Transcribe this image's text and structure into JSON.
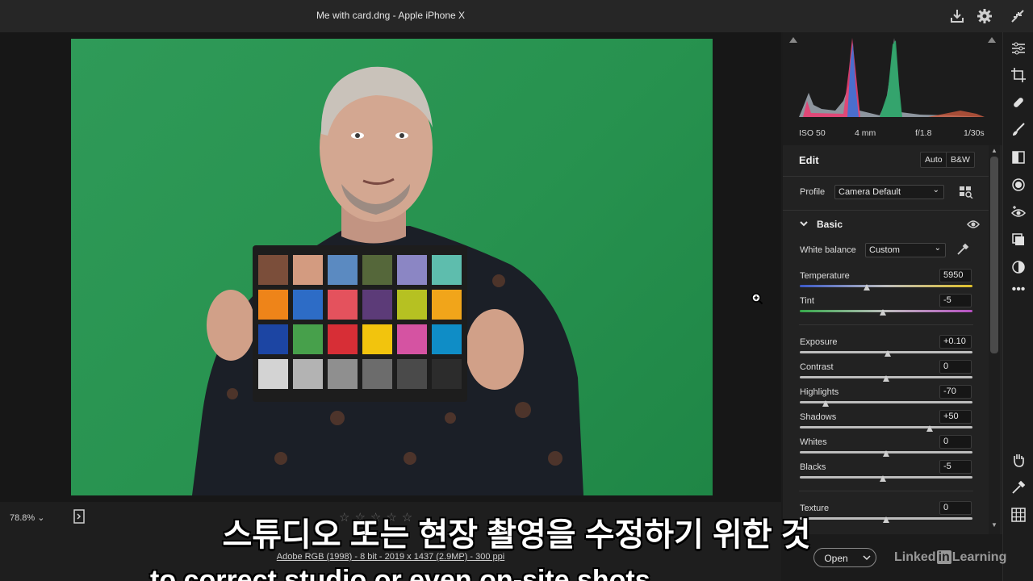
{
  "window": {
    "title": "Me with card.dng  -  Apple iPhone X"
  },
  "icons": {
    "export": "download-icon",
    "settings": "gear-icon",
    "collapse": "minimize-arrows-icon",
    "zoom": "zoom-in-cursor-icon"
  },
  "photo": {
    "description_colors": {
      "background": "#2a9553"
    }
  },
  "histogram": {
    "exif": {
      "iso": "ISO 50",
      "focal": "4 mm",
      "aperture": "f/1.8",
      "shutter": "1/30s"
    }
  },
  "edit": {
    "title": "Edit",
    "auto_label": "Auto",
    "bw_label": "B&W",
    "profile_label": "Profile",
    "profile_value": "Camera Default",
    "basic_label": "Basic",
    "white_balance_label": "White balance",
    "white_balance_value": "Custom",
    "sliders": [
      {
        "label": "Temperature",
        "value": "5950",
        "pos": 0.39
      },
      {
        "label": "Tint",
        "value": "-5",
        "pos": 0.48
      },
      {
        "label": "Exposure",
        "value": "+0.10",
        "pos": 0.51
      },
      {
        "label": "Contrast",
        "value": "0",
        "pos": 0.5
      },
      {
        "label": "Highlights",
        "value": "-70",
        "pos": 0.15
      },
      {
        "label": "Shadows",
        "value": "+50",
        "pos": 0.75
      },
      {
        "label": "Whites",
        "value": "0",
        "pos": 0.5
      },
      {
        "label": "Blacks",
        "value": "-5",
        "pos": 0.48
      },
      {
        "label": "Texture",
        "value": "0",
        "pos": 0.5
      }
    ]
  },
  "footer": {
    "zoom_level": "78.8%",
    "file_info": "Adobe RGB (1998) - 8 bit - 2019 x 1437 (2.9MP) - 300 ppi",
    "open_label": "Open",
    "stars": "☆☆☆☆☆"
  },
  "caption": {
    "korean": "스튜디오 또는 현장 촬영을 수정하기 위한 것",
    "english": "to correct studio or even on-site shots"
  },
  "watermark": {
    "pre": "Linked",
    "in": "in",
    "post": "Learning"
  },
  "colors": {
    "panel_bg": "#222222",
    "green_backdrop": "#2a9553"
  }
}
